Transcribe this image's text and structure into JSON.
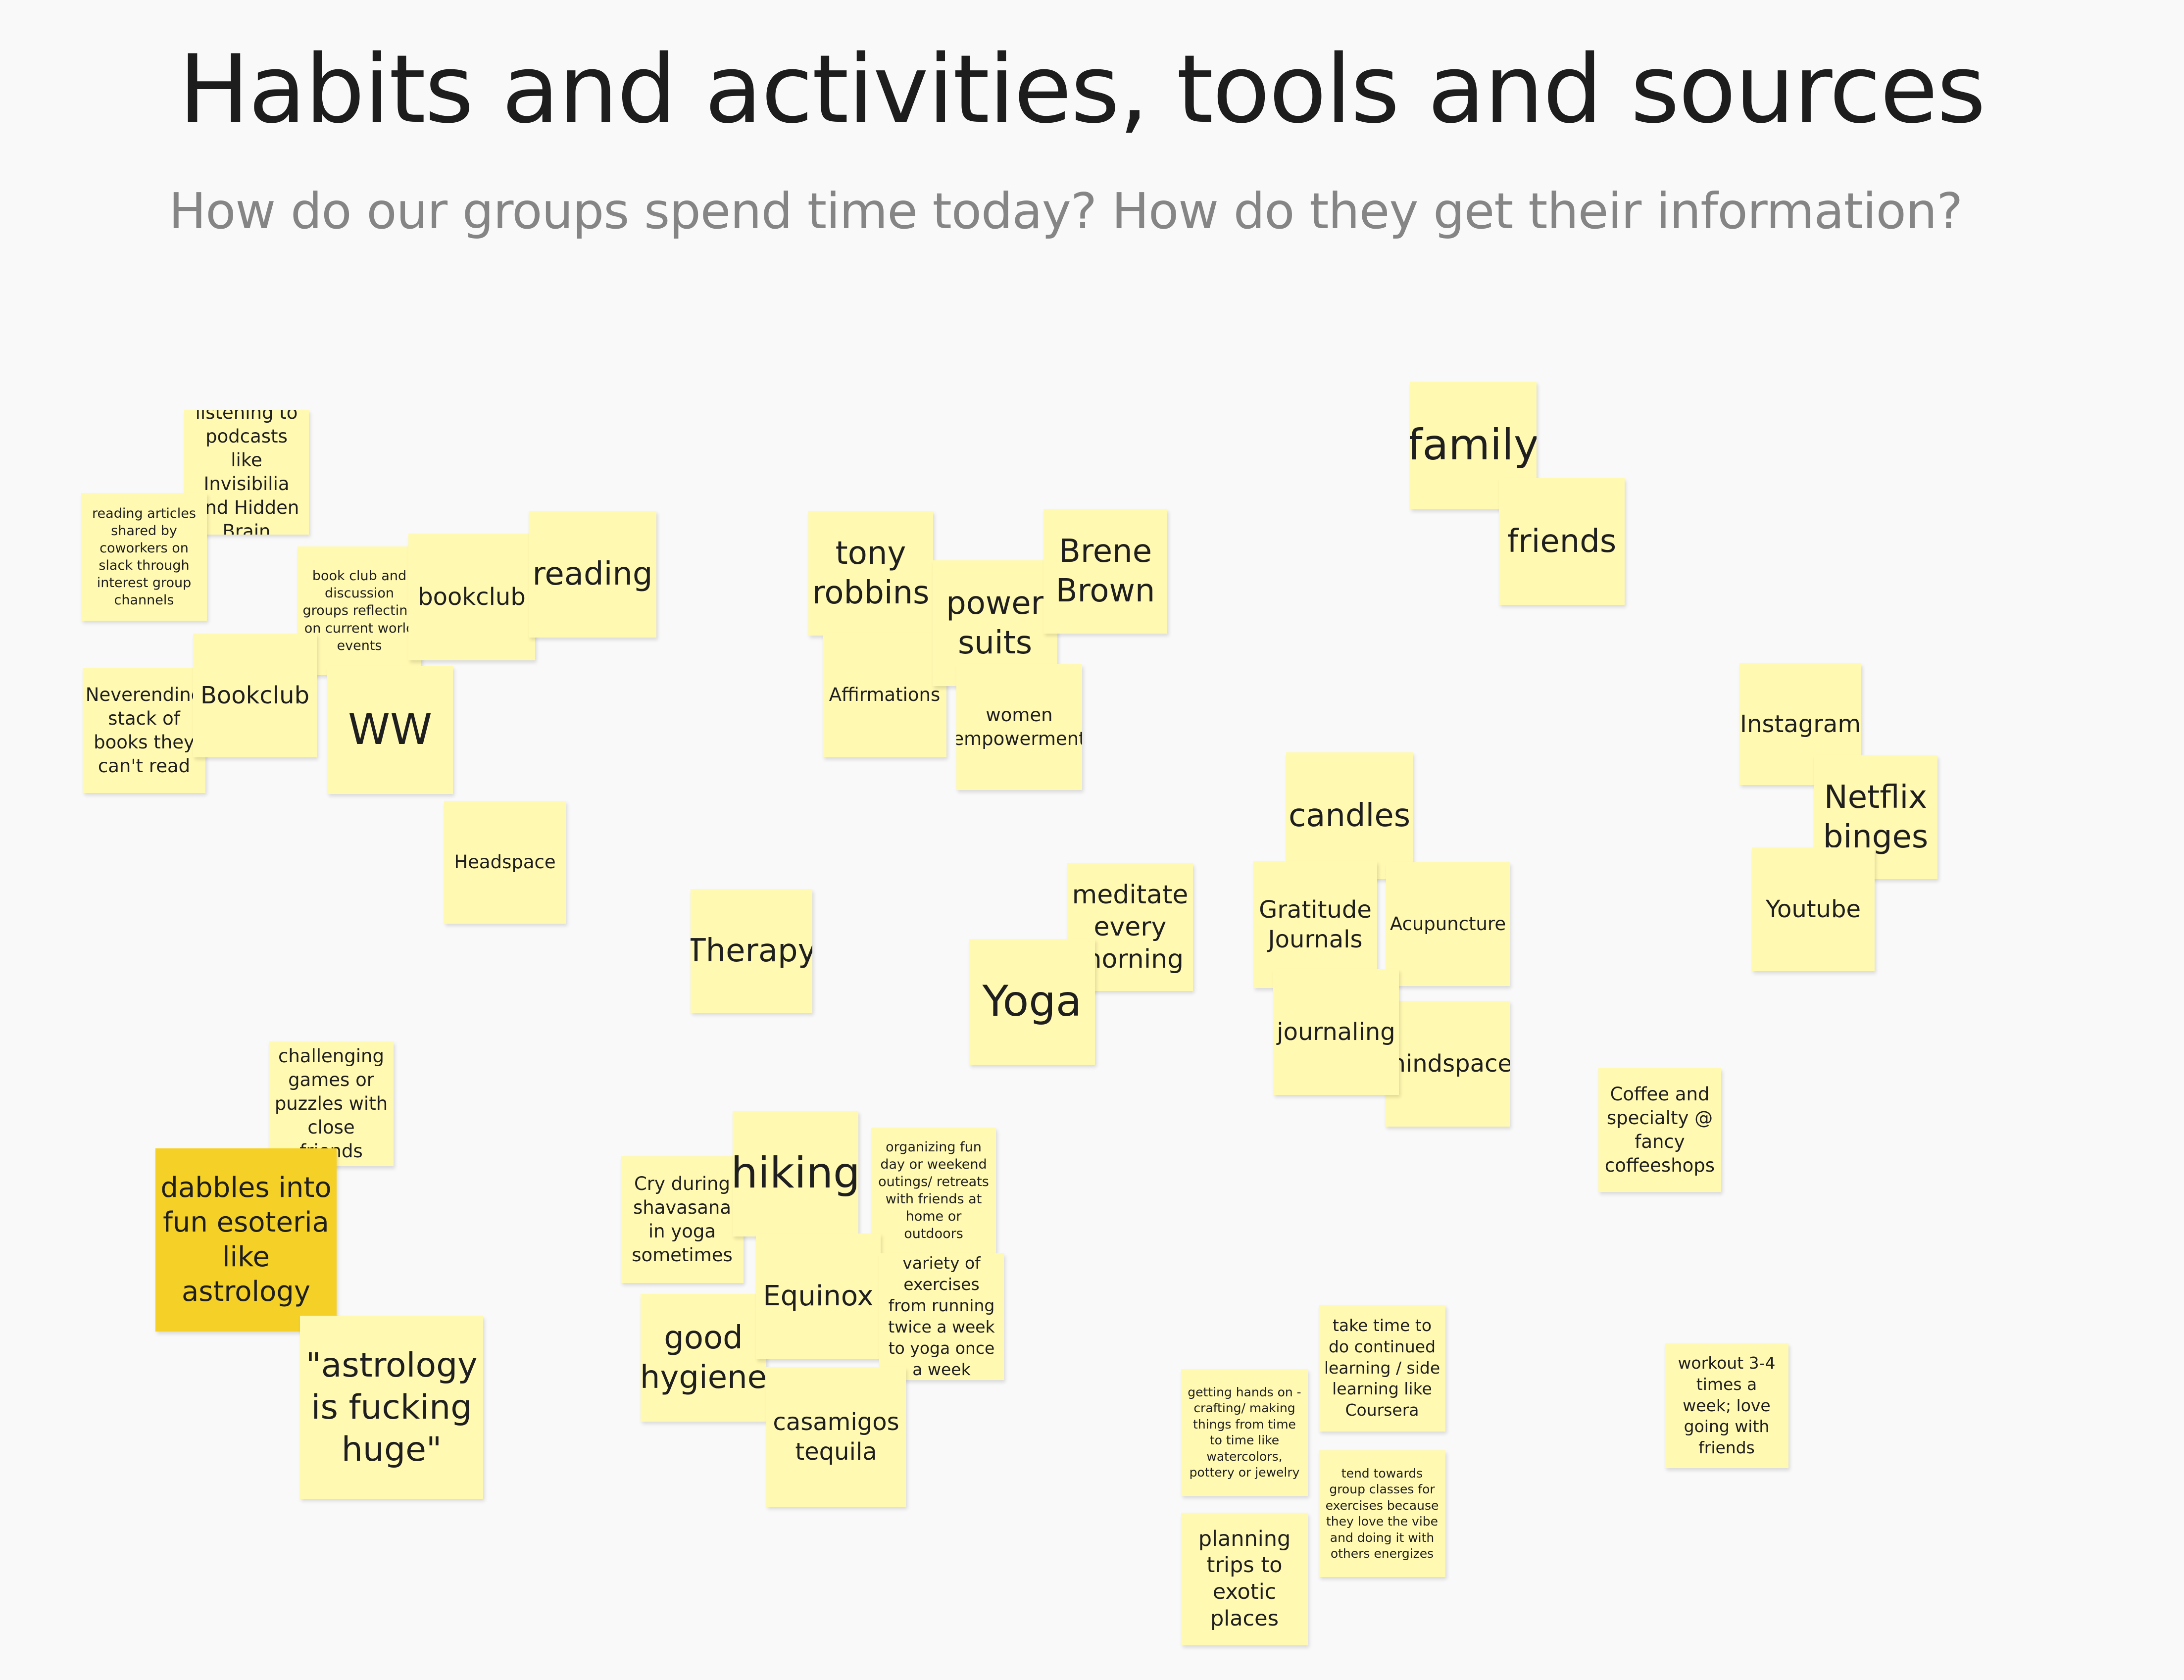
{
  "board": {
    "title": "Habits and activities, tools and sources",
    "subtitle": "How do our groups spend time today? How do they get their information?"
  },
  "notes": [
    {
      "id": "podcasts",
      "text": "listening to podcasts like Invisibilia and Hidden Brain"
    },
    {
      "id": "reading-articles",
      "text": "reading articles shared by coworkers on slack through interest group channels"
    },
    {
      "id": "book-club-discussion",
      "text": "book club and discussion groups reflecting on current world events"
    },
    {
      "id": "bookclub-1",
      "text": "bookclub"
    },
    {
      "id": "reading",
      "text": "reading"
    },
    {
      "id": "neverending-stack",
      "text": "Neverending stack of books they can't read"
    },
    {
      "id": "bookclub-2",
      "text": "Bookclub"
    },
    {
      "id": "ww",
      "text": "WW"
    },
    {
      "id": "headspace",
      "text": "Headspace"
    },
    {
      "id": "tony-robbins",
      "text": "tony robbins"
    },
    {
      "id": "affirmations",
      "text": "Affirmations"
    },
    {
      "id": "power-suits",
      "text": "power suits"
    },
    {
      "id": "brene-brown",
      "text": "Brene Brown"
    },
    {
      "id": "women-empowerment",
      "text": "women empowerment"
    },
    {
      "id": "family",
      "text": "family"
    },
    {
      "id": "friends",
      "text": "friends"
    },
    {
      "id": "instagram",
      "text": "Instagram"
    },
    {
      "id": "netflix-binges",
      "text": "Netflix binges"
    },
    {
      "id": "youtube",
      "text": "Youtube"
    },
    {
      "id": "candles",
      "text": "candles"
    },
    {
      "id": "gratitude-journals",
      "text": "Gratitude Journals"
    },
    {
      "id": "acupuncture",
      "text": "Acupuncture"
    },
    {
      "id": "journaling",
      "text": "journaling"
    },
    {
      "id": "mindspace",
      "text": "mindspace"
    },
    {
      "id": "therapy",
      "text": "Therapy"
    },
    {
      "id": "meditate",
      "text": "meditate every morning"
    },
    {
      "id": "yoga",
      "text": "Yoga"
    },
    {
      "id": "challenging-games",
      "text": "challenging games or puzzles with close friends"
    },
    {
      "id": "dabbles-esoteria",
      "text": "dabbles into fun esoteria like astrology"
    },
    {
      "id": "astrology-huge",
      "text": "\"astrology is fucking huge\""
    },
    {
      "id": "cry-shavasana",
      "text": "Cry during shavasana in yoga sometimes"
    },
    {
      "id": "hiking",
      "text": "hiking"
    },
    {
      "id": "organizing-fun-day",
      "text": "organizing fun day or weekend outings/ retreats with friends at home or outdoors"
    },
    {
      "id": "equinox",
      "text": "Equinox"
    },
    {
      "id": "variety-exercises",
      "text": "variety of exercises from running twice a week to yoga once a week"
    },
    {
      "id": "good-hygiene",
      "text": "good hygiene"
    },
    {
      "id": "casamigos",
      "text": "casamigos tequila"
    },
    {
      "id": "coffee",
      "text": "Coffee and specialty @ fancy coffeeshops"
    },
    {
      "id": "continued-learning",
      "text": "take time to do continued learning / side learning like Coursera"
    },
    {
      "id": "crafting",
      "text": "getting hands on - crafting/ making things from time to time like watercolors, pottery or jewelry"
    },
    {
      "id": "group-classes",
      "text": "tend towards group classes for exercises because they love the vibe and doing it with others energizes"
    },
    {
      "id": "planning-trips",
      "text": "planning trips to exotic places"
    },
    {
      "id": "workout",
      "text": "workout 3-4 times a week; love going with friends"
    }
  ]
}
